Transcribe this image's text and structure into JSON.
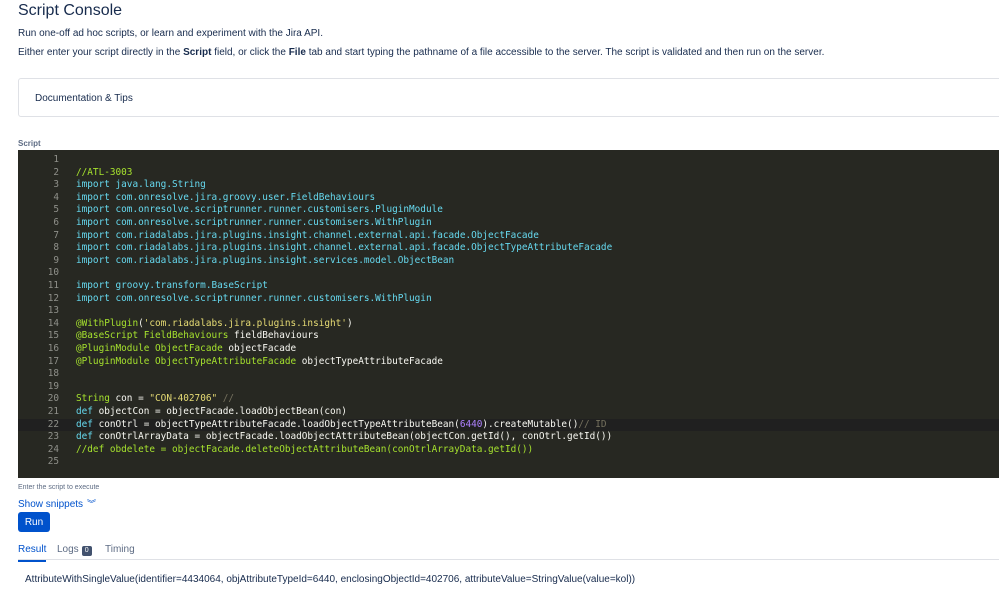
{
  "page": {
    "title": "Script Console",
    "intro": "Run one-off ad hoc scripts, or learn and experiment with the Jira API.",
    "desc_prefix": "Either enter your script directly in the ",
    "desc_script": "Script",
    "desc_mid": " field, or click the ",
    "desc_file": "File",
    "desc_suffix": " tab and start typing the pathname of a file accessible to the server. The script is validated and then run on the server."
  },
  "docs_panel": {
    "label": "Documentation & Tips"
  },
  "editor": {
    "label": "Script",
    "lines": [
      {
        "n": "1",
        "code": [
          {
            "t": "",
            "c": "tx"
          }
        ]
      },
      {
        "n": "2",
        "code": [
          {
            "t": "//ATL-3003",
            "c": "cm2"
          }
        ]
      },
      {
        "n": "3",
        "code": [
          {
            "t": "import ",
            "c": "kw"
          },
          {
            "t": "java.lang.String",
            "c": "kw"
          }
        ]
      },
      {
        "n": "4",
        "code": [
          {
            "t": "import ",
            "c": "kw"
          },
          {
            "t": "com.onresolve.jira.groovy.user.FieldBehaviours",
            "c": "kw"
          }
        ]
      },
      {
        "n": "5",
        "code": [
          {
            "t": "import ",
            "c": "kw"
          },
          {
            "t": "com.onresolve.scriptrunner.runner.customisers.PluginModule",
            "c": "kw"
          }
        ]
      },
      {
        "n": "6",
        "code": [
          {
            "t": "import ",
            "c": "kw"
          },
          {
            "t": "com.onresolve.scriptrunner.runner.customisers.WithPlugin",
            "c": "kw"
          }
        ]
      },
      {
        "n": "7",
        "code": [
          {
            "t": "import ",
            "c": "kw"
          },
          {
            "t": "com.riadalabs.jira.plugins.insight.channel.external.api.facade.ObjectFacade",
            "c": "kw"
          }
        ]
      },
      {
        "n": "8",
        "code": [
          {
            "t": "import ",
            "c": "kw"
          },
          {
            "t": "com.riadalabs.jira.plugins.insight.channel.external.api.facade.ObjectTypeAttributeFacade",
            "c": "kw"
          }
        ]
      },
      {
        "n": "9",
        "code": [
          {
            "t": "import ",
            "c": "kw"
          },
          {
            "t": "com.riadalabs.jira.plugins.insight.services.model.ObjectBean",
            "c": "kw"
          }
        ]
      },
      {
        "n": "10",
        "code": [
          {
            "t": "",
            "c": "tx"
          }
        ]
      },
      {
        "n": "11",
        "code": [
          {
            "t": "import ",
            "c": "kw"
          },
          {
            "t": "groovy.transform.BaseScript",
            "c": "kw"
          }
        ]
      },
      {
        "n": "12",
        "code": [
          {
            "t": "import ",
            "c": "kw"
          },
          {
            "t": "com.onresolve.scriptrunner.runner.customisers.WithPlugin",
            "c": "kw"
          }
        ]
      },
      {
        "n": "13",
        "code": [
          {
            "t": "",
            "c": "tx"
          }
        ]
      },
      {
        "n": "14",
        "code": [
          {
            "t": "@WithPlugin",
            "c": "an"
          },
          {
            "t": "(",
            "c": "tx"
          },
          {
            "t": "'com.riadalabs.jira.plugins.insight'",
            "c": "st"
          },
          {
            "t": ")",
            "c": "tx"
          }
        ]
      },
      {
        "n": "15",
        "code": [
          {
            "t": "@BaseScript ",
            "c": "an"
          },
          {
            "t": "FieldBehaviours ",
            "c": "ty"
          },
          {
            "t": "fieldBehaviours",
            "c": "tx"
          }
        ]
      },
      {
        "n": "16",
        "code": [
          {
            "t": "@PluginModule ",
            "c": "an"
          },
          {
            "t": "ObjectFacade ",
            "c": "ty"
          },
          {
            "t": "objectFacade",
            "c": "tx"
          }
        ]
      },
      {
        "n": "17",
        "code": [
          {
            "t": "@PluginModule ",
            "c": "an"
          },
          {
            "t": "ObjectTypeAttributeFacade ",
            "c": "ty"
          },
          {
            "t": "objectTypeAttributeFacade",
            "c": "tx"
          }
        ]
      },
      {
        "n": "18",
        "code": [
          {
            "t": "",
            "c": "tx"
          }
        ]
      },
      {
        "n": "19",
        "code": [
          {
            "t": "",
            "c": "tx"
          }
        ]
      },
      {
        "n": "20",
        "code": [
          {
            "t": "String ",
            "c": "ty"
          },
          {
            "t": "con = ",
            "c": "tx"
          },
          {
            "t": "\"CON-402706\"",
            "c": "st"
          },
          {
            "t": " //",
            "c": "cm"
          }
        ]
      },
      {
        "n": "21",
        "code": [
          {
            "t": "def ",
            "c": "kw"
          },
          {
            "t": "objectCon = objectFacade.loadObjectBean(con)",
            "c": "tx"
          }
        ]
      },
      {
        "n": "22",
        "code": [
          {
            "t": "def ",
            "c": "kw"
          },
          {
            "t": "conOtrl = objectTypeAttributeFacade.loadObjectTypeAttributeBean(",
            "c": "tx"
          },
          {
            "t": "6440",
            "c": "num"
          },
          {
            "t": ").createMutable()",
            "c": "tx"
          },
          {
            "t": "// ID",
            "c": "cm"
          }
        ],
        "active": true
      },
      {
        "n": "23",
        "code": [
          {
            "t": "def ",
            "c": "kw"
          },
          {
            "t": "conOtrlArrayData = objectFacade.loadObjectAttributeBean(objectCon.getId(), conOtrl.getId())",
            "c": "tx"
          }
        ]
      },
      {
        "n": "24",
        "code": [
          {
            "t": "//def obdelete = objectFacade.deleteObjectAttributeBean(conOtrlArrayData.getId())",
            "c": "cm2"
          }
        ]
      },
      {
        "n": "25",
        "code": [
          {
            "t": "",
            "c": "tx"
          }
        ]
      }
    ],
    "hint": "Enter the script to execute"
  },
  "snippets": {
    "label": "Show snippets",
    "icon": "double-chevron-down-icon"
  },
  "run_button": {
    "label": "Run"
  },
  "tabs": [
    {
      "label": "Result",
      "active": true
    },
    {
      "label": "Logs",
      "badge": "0"
    },
    {
      "label": "Timing"
    }
  ],
  "result": {
    "text": "AttributeWithSingleValue(identifier=4434064, objAttributeTypeId=6440, enclosingObjectId=402706, attributeValue=StringValue(value=kol))"
  },
  "colors": {
    "accent": "#0052cc",
    "editor_bg": "#272822"
  }
}
